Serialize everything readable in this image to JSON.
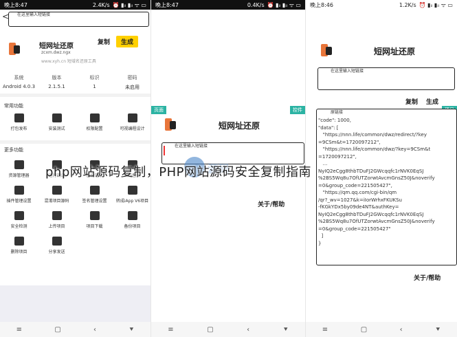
{
  "panel1": {
    "status": {
      "time": "晚上8:47",
      "speed": "2.4K/s",
      "icons": "⏰ ▮ᵢₗ ▮ᵢₗ ᯤ ▭"
    },
    "back_glyph": "<",
    "input_hint": "在这里输入短链接",
    "app_name": "短网址还原",
    "app_url": "zcxm.dwz.ngx",
    "copy_label": "复制",
    "generate_label": "生成",
    "url_line": "www.xyh.cn  短域名还原工具",
    "stats": [
      {
        "label": "系统",
        "value": "Android 4.0.3"
      },
      {
        "label": "版本",
        "value": "2.1.5.1"
      },
      {
        "label": "标识",
        "value": "1"
      },
      {
        "label": "密码",
        "value": "未启用"
      }
    ],
    "section_common": "常用功能",
    "common_items": [
      {
        "label": "打包发布",
        "icon": "download-icon"
      },
      {
        "label": "安装测试",
        "icon": "test-icon"
      },
      {
        "label": "权限配置",
        "icon": "tools-icon"
      },
      {
        "label": "可视编程设计",
        "icon": "puzzle-icon"
      }
    ],
    "section_more": "更多功能",
    "more_items": [
      {
        "label": "资源管理器",
        "icon": "folder-icon"
      },
      {
        "label": "运行调试",
        "icon": "settings-icon"
      },
      {
        "label": "备份还原",
        "icon": "copy-icon"
      },
      {
        "label": "图标替换",
        "icon": "image-icon"
      },
      {
        "label": "插件管理设置",
        "icon": "plugin-icon"
      },
      {
        "label": "混淆项目源码",
        "icon": "code-icon"
      },
      {
        "label": "签名管理设置",
        "icon": "android-icon"
      },
      {
        "label": "转成iApp V6项目",
        "icon": "refresh-icon"
      },
      {
        "label": "安全检测",
        "icon": "shield-icon"
      },
      {
        "label": "上传项目",
        "icon": "cloud-upload-icon"
      },
      {
        "label": "项目下载",
        "icon": "download-icon"
      },
      {
        "label": "备份项目",
        "icon": "save-icon"
      },
      {
        "label": "删除项目",
        "icon": "trash-icon"
      },
      {
        "label": "分享发送",
        "icon": "share-icon"
      }
    ],
    "nav": [
      "≡",
      "▢",
      "‹",
      "⯆"
    ]
  },
  "panel2": {
    "status": {
      "time": "晚上8:47",
      "speed": "0.4K/s",
      "icons": "⏰ ▮ᵢₗ ▮ᵢₗ ᯤ ▭"
    },
    "tag_left": "页面",
    "tag_right": "控件",
    "app_name": "短网址还原",
    "input_hint": "在这里输入短链接",
    "about_label": "关于/帮助",
    "nav": [
      "≡",
      "▢",
      "‹",
      "⯆"
    ]
  },
  "panel3": {
    "status": {
      "time": "晚上8:46",
      "speed": "1.2K/s",
      "icons": "⏰ ▮ᵢₗ ▮ᵢₗ ᯤ ▭"
    },
    "app_name": "短网址还原",
    "input_hint": "在这里输入短链接",
    "copy_label": "复制",
    "generate_label": "生成",
    "tag_right": "项目",
    "result_label": "原链接",
    "result_text": "\"code\": 1000,\n\"data\": [\n   \"https://nnn.life/common/dwz/redirect/?key\n=9CSm&t=1720097212\",\n   \"https://nnn.life/common/dwz/?key=9CSm&t\n=1720097212\",\n   ...\nNyIQ2eCgg8thbTDuFJ2GWcqqfc1rNVK0EqSJ\n%2BS5Wq8u7OfUTZorwtAvcmGnsZ50J&noverify\n=0&group_code=221505427\",\n   \"https://qm.qq.com/cgi-bin/qm\n/qr?_wv=1027&k=iIorWrhxFKUKSu\n-fKGkYDx5by09de4NT&authKey=\nNyIQ2eCgg8thbTDuFJ2GWcqqfc1rNVK0EqSJ\n%2BS5Wq8u7OfUTZorwtAvcmGnsZ50J&noverify\n=0&group_code=221505427\"\n  ]\n}",
    "about_label": "关于/帮助",
    "nav": [
      "≡",
      "▢",
      "‹",
      "⯆"
    ]
  },
  "overlay_title": "php网站源码复制，PHP网站源码安全复制指南",
  "watermark_text": "源码",
  "colors": {
    "accent_yellow": "#ffd000",
    "logo_orange": "#e8753a",
    "tag_teal": "#2bb3a3"
  }
}
